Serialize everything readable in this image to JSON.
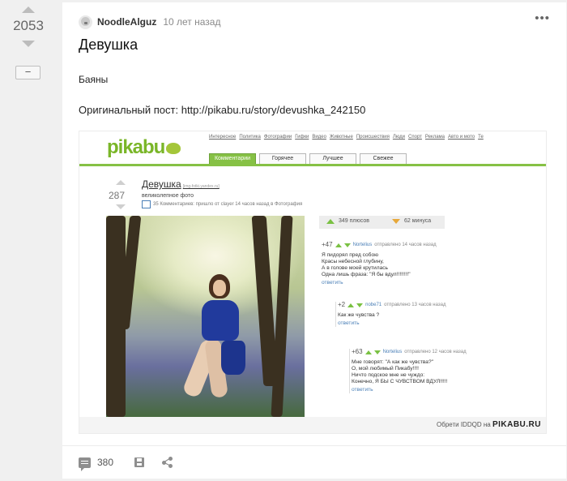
{
  "post": {
    "rating": "2053",
    "collapse_label": "−",
    "author": "NoodleAlguz",
    "time": "10 лет назад",
    "menu": "•••",
    "title": "Девушка",
    "tag": "Баяны",
    "source": "Оригинальный пост: http://pikabu.ru/story/devushka_242150",
    "comments_count": "380"
  },
  "screenshot": {
    "logo": "pikabu",
    "nav": [
      "Интересное",
      "Политика",
      "Фотографии",
      "Гифки",
      "Видео",
      "Животные",
      "Происшествия",
      "Люди",
      "Спорт",
      "Реклама",
      "Авто и мото",
      "Те"
    ],
    "tabs": [
      "Комментарии",
      "Горячее",
      "Лучшее",
      "Свежее"
    ],
    "vote": "287",
    "title": "Девушка",
    "title_src": "[img-fotki.yandex.ru]",
    "desc": "великолепное фото",
    "meta": "35 Комментариев: пришло от clayer 14 часов назад в Фотография",
    "plus": "349 плюсов",
    "minus": "62 минуса",
    "c1": {
      "score": "+47",
      "author": "Nortelius",
      "meta": "отправлено 14 часов назад",
      "lines": [
        "Я пидорял пред собою",
        "Красы небесной глубину,",
        "А в голове моей крутилась",
        "Одна лишь фраза: \"Я бы вдул!!!!!!!!\""
      ],
      "reply": "ответить"
    },
    "c2": {
      "score": "+2",
      "author": "nobe71",
      "meta": "отправлено 13 часов назад",
      "lines": [
        "Как же чувства ?"
      ],
      "reply": "ответить"
    },
    "c3": {
      "score": "+63",
      "author": "Nortelius",
      "meta": "отправлено 12 часов назад",
      "lines": [
        "Мне говорят: \"А как же чувства?\"",
        "О, мой любимый Пикабу!!!!",
        "Ничто подское мне не чуждо:",
        "Конечно, Я БЫ С ЧУВСТВОМ ВДУЛ!!!!!"
      ],
      "reply": "ответить"
    },
    "footer_prefix": "Обрети IDDQD на",
    "footer_brand": "PIKABU.RU",
    "footer_small": "pikabu.ru"
  }
}
